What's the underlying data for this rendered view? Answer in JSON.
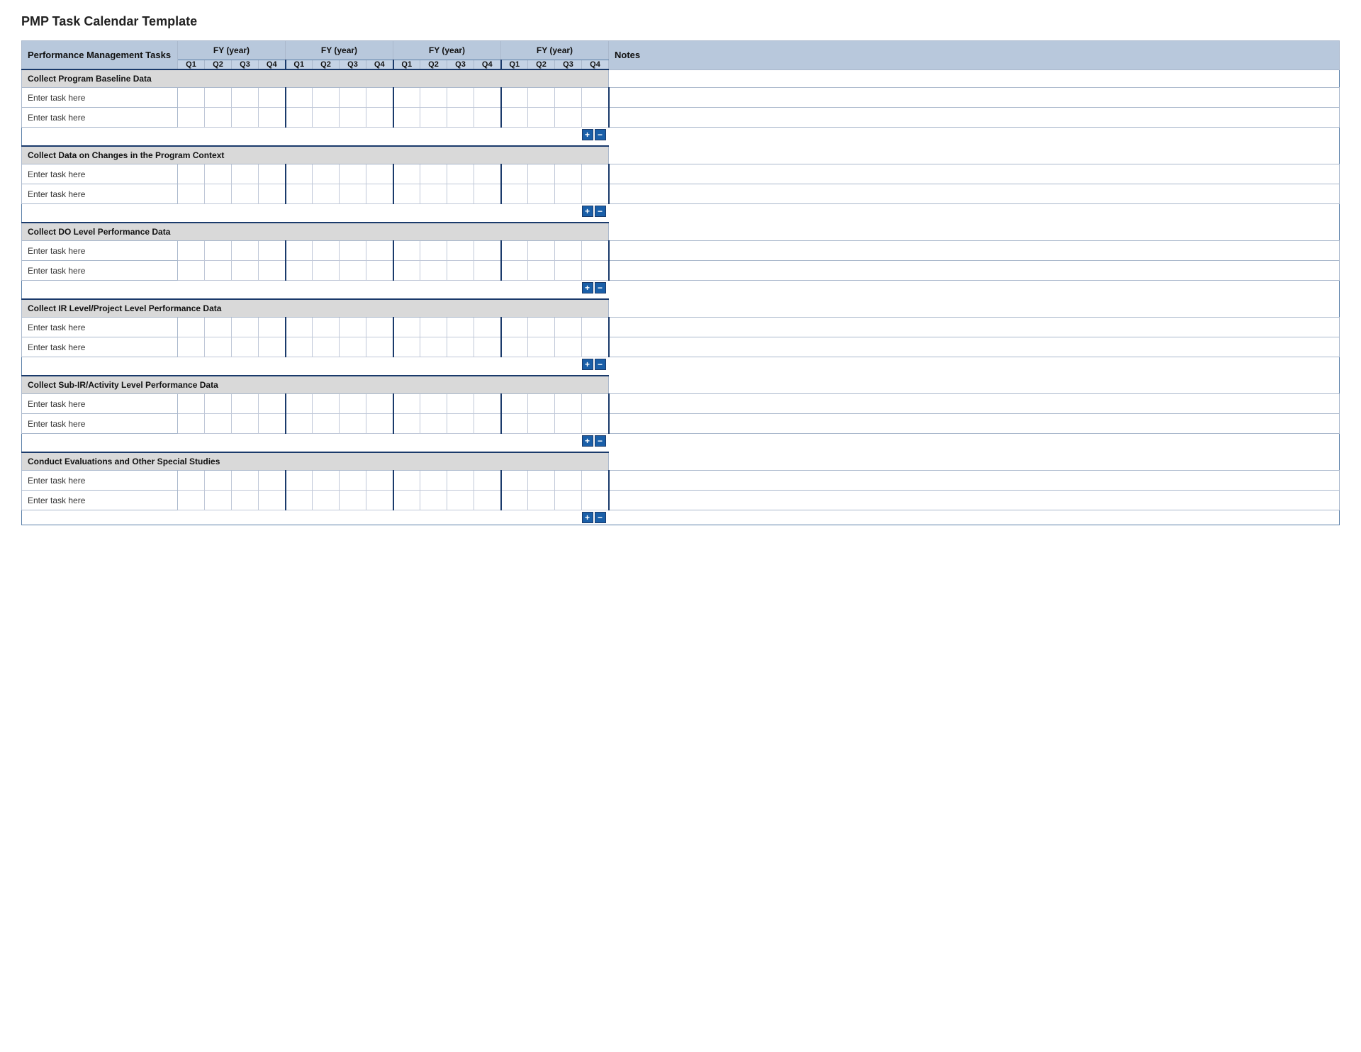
{
  "page": {
    "title": "PMP Task Calendar Template"
  },
  "header": {
    "task_col_label": "Performance Management Tasks",
    "notes_col_label": "Notes",
    "fy_label": "FY  (year)",
    "quarters": [
      "Q1",
      "Q2",
      "Q3",
      "Q4"
    ]
  },
  "sections": [
    {
      "id": "section-1",
      "label": "Collect Program Baseline Data",
      "tasks": [
        {
          "label": "Enter task here"
        },
        {
          "label": "Enter task here"
        }
      ]
    },
    {
      "id": "section-2",
      "label": "Collect Data on Changes in the Program Context",
      "tasks": [
        {
          "label": "Enter task here"
        },
        {
          "label": "Enter task here"
        }
      ]
    },
    {
      "id": "section-3",
      "label": "Collect DO Level Performance Data",
      "tasks": [
        {
          "label": "Enter task here"
        },
        {
          "label": "Enter task here"
        }
      ]
    },
    {
      "id": "section-4",
      "label": "Collect IR Level/Project Level Performance Data",
      "tasks": [
        {
          "label": "Enter task here"
        },
        {
          "label": "Enter task here"
        }
      ]
    },
    {
      "id": "section-5",
      "label": "Collect Sub-IR/Activity Level Performance Data",
      "tasks": [
        {
          "label": "Enter task here"
        },
        {
          "label": "Enter task here"
        }
      ]
    },
    {
      "id": "section-6",
      "label": "Conduct Evaluations and Other Special Studies",
      "tasks": [
        {
          "label": "Enter task here"
        },
        {
          "label": "Enter task here"
        }
      ]
    }
  ],
  "controls": {
    "plus_label": "+",
    "minus_label": "−"
  }
}
